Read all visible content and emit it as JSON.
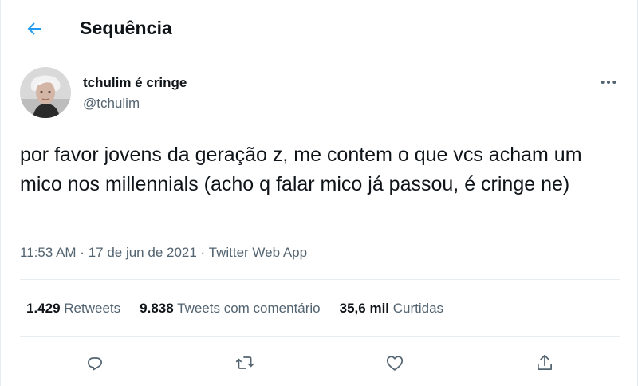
{
  "header": {
    "title": "Sequência"
  },
  "tweet": {
    "author_name": "tchulim é cringe",
    "author_handle": "@tchulim",
    "text": "por favor jovens da geração z, me contem o que vcs acham um mico nos millennials (acho q falar mico já passou, é cringe ne)",
    "time": "11:53 AM",
    "separator": " · ",
    "date": "17 de jun de 2021",
    "source": "Twitter Web App"
  },
  "stats": {
    "retweets_count": "1.429",
    "retweets_label": "Retweets",
    "quotes_count": "9.838",
    "quotes_label": "Tweets com comentário",
    "likes_count": "35,6 mil",
    "likes_label": "Curtidas"
  },
  "icons": {
    "back": "arrow-left-icon",
    "more": "more-dots-icon",
    "reply": "reply-icon",
    "retweet": "retweet-icon",
    "like": "heart-icon",
    "share": "share-icon"
  },
  "colors": {
    "accent": "#1d9bf0",
    "text_primary": "#0f1419",
    "text_secondary": "#536471",
    "divider": "#e6ecf0"
  }
}
